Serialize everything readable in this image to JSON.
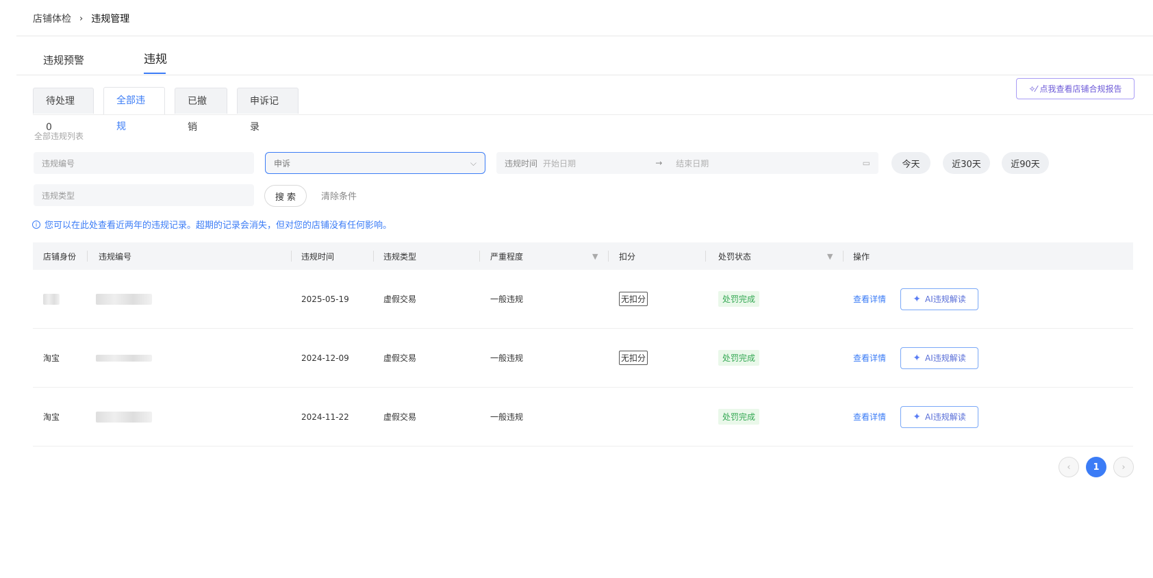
{
  "breadcrumb": {
    "parent": "店铺体检",
    "separator": "›",
    "current": "违规管理"
  },
  "main_tabs": [
    {
      "label": "违规预警",
      "active": false
    },
    {
      "label": "违规",
      "active": true
    }
  ],
  "sub_tabs": [
    {
      "label": "待处理 0",
      "active": false
    },
    {
      "label": "全部违规",
      "active": true
    },
    {
      "label": "已撤销",
      "active": false
    },
    {
      "label": "申诉记录",
      "active": false
    }
  ],
  "report_button": {
    "icon": "sparkle-wand-icon",
    "label": "点我查看店铺合规报告"
  },
  "section_title": "全部违规列表",
  "filters": {
    "violation_no_placeholder": "违规编号",
    "appeal_select_value": "申诉",
    "date_label": "违规时间",
    "start_placeholder": "开始日期",
    "end_placeholder": "结束日期",
    "type_placeholder": "违规类型",
    "quick_ranges": [
      "今天",
      "近30天",
      "近90天"
    ],
    "search_label": "搜 索",
    "clear_label": "清除条件"
  },
  "notice": "您可以在此处查看近两年的违规记录。超期的记录会消失，但对您的店铺没有任何影响。",
  "table": {
    "columns": [
      "店铺身份",
      "违规编号",
      "违规时间",
      "违规类型",
      "严重程度",
      "扣分",
      "处罚状态",
      "操作"
    ],
    "rows": [
      {
        "store": "",
        "date": "2025-05-19",
        "type": "虚假交易",
        "severity": "一般违规",
        "score": "无扣分",
        "status": "处罚完成",
        "detail": "查看详情",
        "ai": "AI违规解读"
      },
      {
        "store": "淘宝",
        "date": "2024-12-09",
        "type": "虚假交易",
        "severity": "一般违规",
        "score": "无扣分",
        "status": "处罚完成",
        "detail": "查看详情",
        "ai": "AI违规解读"
      },
      {
        "store": "淘宝",
        "date": "2024-11-22",
        "type": "虚假交易",
        "severity": "一般违规",
        "score": "",
        "status": "处罚完成",
        "detail": "查看详情",
        "ai": "AI违规解读"
      }
    ]
  },
  "pagination": {
    "prev": "‹",
    "current": "1",
    "next": "›"
  },
  "colors": {
    "accent": "#3b7cf6",
    "success": "#34a853",
    "purple": "#6d5bd8"
  }
}
